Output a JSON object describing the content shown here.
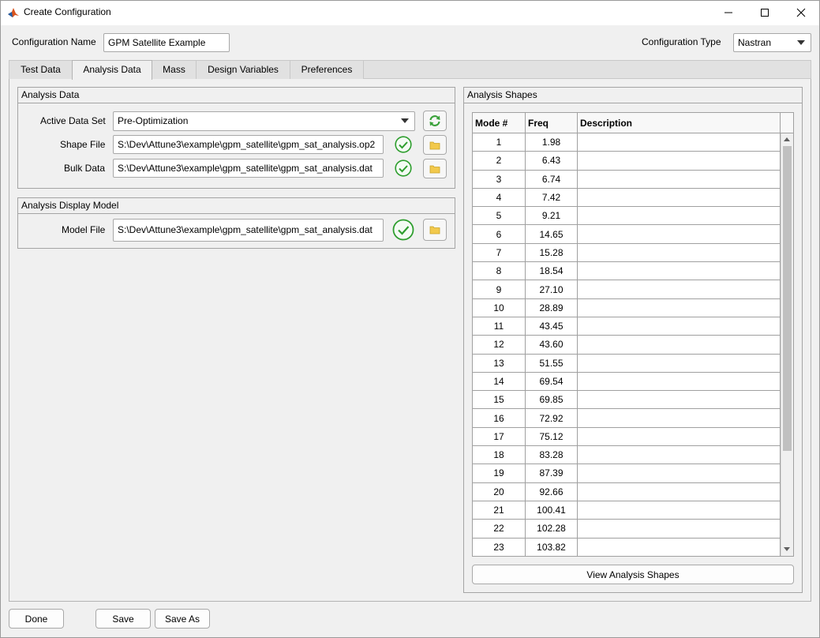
{
  "window": {
    "title": "Create Configuration"
  },
  "config": {
    "name_label": "Configuration Name",
    "name_value": "GPM Satellite Example",
    "type_label": "Configuration Type",
    "type_value": "Nastran"
  },
  "tabs": [
    {
      "label": "Test Data",
      "active": false
    },
    {
      "label": "Analysis Data",
      "active": true
    },
    {
      "label": "Mass",
      "active": false
    },
    {
      "label": "Design Variables",
      "active": false
    },
    {
      "label": "Preferences",
      "active": false
    }
  ],
  "analysis_data": {
    "title": "Analysis Data",
    "active_data_set_label": "Active Data Set",
    "active_data_set_value": "Pre-Optimization",
    "shape_file_label": "Shape File",
    "shape_file_value": "S:\\Dev\\Attune3\\example\\gpm_satellite\\gpm_sat_analysis.op2",
    "bulk_data_label": "Bulk Data",
    "bulk_data_value": "S:\\Dev\\Attune3\\example\\gpm_satellite\\gpm_sat_analysis.dat"
  },
  "display_model": {
    "title": "Analysis Display Model",
    "model_file_label": "Model File",
    "model_file_value": "S:\\Dev\\Attune3\\example\\gpm_satellite\\gpm_sat_analysis.dat"
  },
  "shapes": {
    "title": "Analysis Shapes",
    "columns": [
      "Mode #",
      "Freq",
      "Description"
    ],
    "rows": [
      {
        "mode": "1",
        "freq": "1.98",
        "desc": ""
      },
      {
        "mode": "2",
        "freq": "6.43",
        "desc": ""
      },
      {
        "mode": "3",
        "freq": "6.74",
        "desc": ""
      },
      {
        "mode": "4",
        "freq": "7.42",
        "desc": ""
      },
      {
        "mode": "5",
        "freq": "9.21",
        "desc": ""
      },
      {
        "mode": "6",
        "freq": "14.65",
        "desc": ""
      },
      {
        "mode": "7",
        "freq": "15.28",
        "desc": ""
      },
      {
        "mode": "8",
        "freq": "18.54",
        "desc": ""
      },
      {
        "mode": "9",
        "freq": "27.10",
        "desc": ""
      },
      {
        "mode": "10",
        "freq": "28.89",
        "desc": ""
      },
      {
        "mode": "11",
        "freq": "43.45",
        "desc": ""
      },
      {
        "mode": "12",
        "freq": "43.60",
        "desc": ""
      },
      {
        "mode": "13",
        "freq": "51.55",
        "desc": ""
      },
      {
        "mode": "14",
        "freq": "69.54",
        "desc": ""
      },
      {
        "mode": "15",
        "freq": "69.85",
        "desc": ""
      },
      {
        "mode": "16",
        "freq": "72.92",
        "desc": ""
      },
      {
        "mode": "17",
        "freq": "75.12",
        "desc": ""
      },
      {
        "mode": "18",
        "freq": "83.28",
        "desc": ""
      },
      {
        "mode": "19",
        "freq": "87.39",
        "desc": ""
      },
      {
        "mode": "20",
        "freq": "92.66",
        "desc": ""
      },
      {
        "mode": "21",
        "freq": "100.41",
        "desc": ""
      },
      {
        "mode": "22",
        "freq": "102.28",
        "desc": ""
      },
      {
        "mode": "23",
        "freq": "103.82",
        "desc": ""
      }
    ],
    "view_button": "View Analysis Shapes"
  },
  "footer": {
    "done": "Done",
    "save": "Save",
    "save_as": "Save As"
  },
  "colors": {
    "check_green": "#2e9e2e",
    "folder_yellow": "#f2c94c",
    "refresh_green": "#3aa13a"
  },
  "icons": [
    "matlab-icon",
    "minimize-icon",
    "maximize-icon",
    "close-icon",
    "refresh-icon",
    "check-icon",
    "folder-icon"
  ]
}
